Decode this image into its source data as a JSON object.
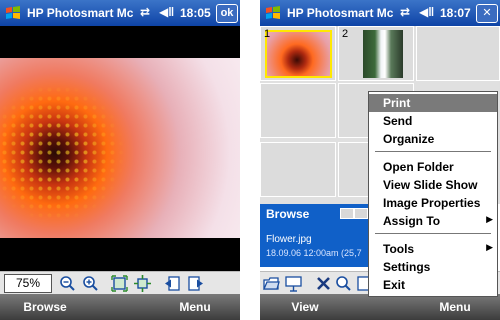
{
  "left_screen": {
    "title": "HP Photosmart Mc",
    "time": "18:05",
    "ok_label": "ok",
    "zoom_value": "75%",
    "softkey_left": "Browse",
    "softkey_right": "Menu"
  },
  "right_screen": {
    "title": "HP Photosmart Mc",
    "time": "18:07",
    "close_label": "✕",
    "thumbnails": [
      {
        "number": "1"
      },
      {
        "number": "2"
      }
    ],
    "info_panel": {
      "title": "Browse",
      "filename": "Flower.jpg",
      "details": "18.09.06 12:00am (25,7"
    },
    "menu": {
      "items": [
        {
          "label": "Print",
          "selected": true
        },
        {
          "label": "Send"
        },
        {
          "label": "Organize"
        },
        {
          "label": "Open Folder"
        },
        {
          "label": "View Slide Show"
        },
        {
          "label": "Image Properties"
        },
        {
          "label": "Assign To",
          "submenu": true
        },
        {
          "label": "Tools",
          "submenu": true
        },
        {
          "label": "Settings"
        },
        {
          "label": "Exit"
        }
      ]
    },
    "softkey_left": "View",
    "softkey_right": "Menu"
  },
  "icons": {
    "start": "windows-logo-icon",
    "connectivity": "connectivity-icon",
    "volume": "speaker-icon",
    "submenu_arrow": "▶"
  },
  "colors": {
    "titlebar": "#0e43a6",
    "info_panel": "#1060c8",
    "selection": "#ffe800",
    "menu_highlight": "#7a7a7a"
  }
}
